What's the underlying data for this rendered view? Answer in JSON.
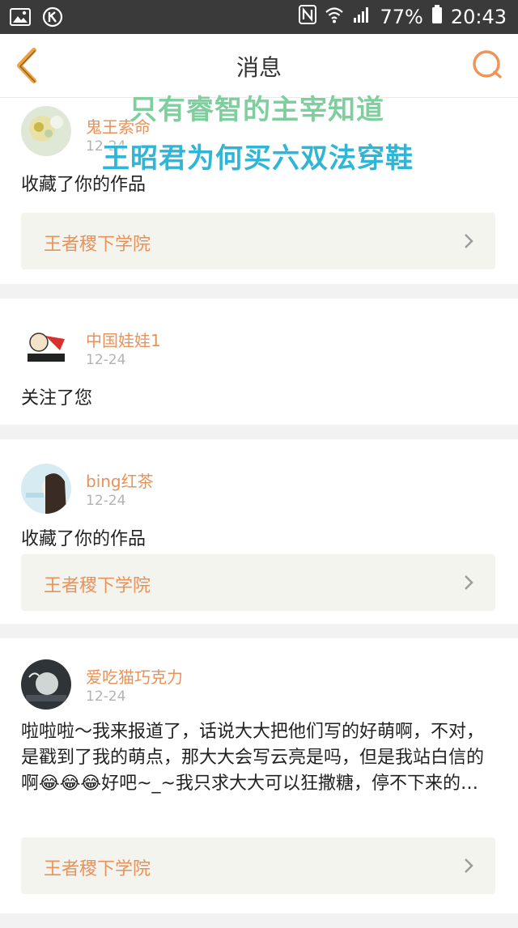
{
  "status_bar": {
    "battery": "77%",
    "time": "20:43"
  },
  "header": {
    "title": "消息"
  },
  "overlay": {
    "line1": "只有睿智的主宰知道",
    "line2": "王昭君为何买六双法穿鞋"
  },
  "messages": [
    {
      "username": "鬼王索命",
      "date": "12-24",
      "action": "收藏了你的作品",
      "link": "王者稷下学院"
    },
    {
      "username": "中国娃娃1",
      "date": "12-24",
      "action": "关注了您"
    },
    {
      "username": "bing红茶",
      "date": "12-24",
      "action": "收藏了你的作品",
      "link": "王者稷下学院"
    },
    {
      "username": "爱吃猫巧克力",
      "date": "12-24",
      "action": "啦啦啦～我来报道了，话说大大把他们写的好萌啊，不对，是戳到了我的萌点，那大大会写云亮是吗，但是我站白信的啊😂😂😂好吧~_~我只求大大可以狂撒糖，停不下来的…",
      "link": "王者稷下学院"
    }
  ],
  "colors": {
    "accent": "#e8925a",
    "status_bar": "#3a3a3a",
    "link_box": "#f4f4ef"
  }
}
